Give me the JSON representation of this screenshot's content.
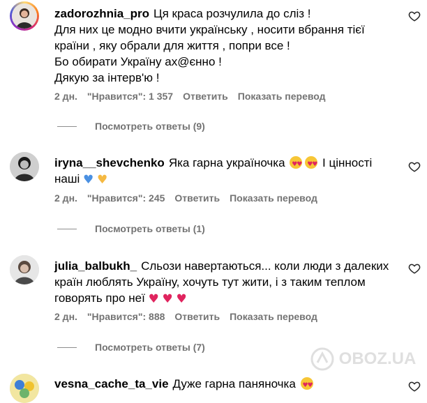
{
  "comments": [
    {
      "username": "zadorozhnia_pro",
      "text": "Ця краса розчулила до сліз !\nДля них це модно вчити українську , носити вбрання тієї країни , яку обрали для життя , попри все !\nБо обирати Україну ах@єнно !\nДякую за інтерв'ю !",
      "time": "2 дн.",
      "likes": "\"Нравится\": 1 357",
      "reply": "Ответить",
      "translate": "Показать перевод",
      "view_replies": "Посмотреть ответы (9)"
    },
    {
      "username": "iryna__shevchenko",
      "text_before": "Яка гарна україночка",
      "text_after": "І цінності наші",
      "heart_colors": [
        "#4a90e2",
        "#f5b942"
      ],
      "time": "2 дн.",
      "likes": "\"Нравится\": 245",
      "reply": "Ответить",
      "translate": "Показать перевод",
      "view_replies": "Посмотреть ответы (1)"
    },
    {
      "username": "julia_balbukh_",
      "text": "Сльози навертаються... коли люди з далеких країн люблять Україну, хочуть тут жити, і з таким теплом говорять про неї",
      "time": "2 дн.",
      "likes": "\"Нравится\": 888",
      "reply": "Ответить",
      "translate": "Показать перевод",
      "view_replies": "Посмотреть ответы (7)"
    },
    {
      "username": "vesna_cache_ta_vie",
      "text": "Дуже гарна паняночка"
    }
  ],
  "watermark": "OBOZ.UA",
  "colors": {
    "meta": "#737373",
    "like_heart_red": "#e0245e"
  }
}
